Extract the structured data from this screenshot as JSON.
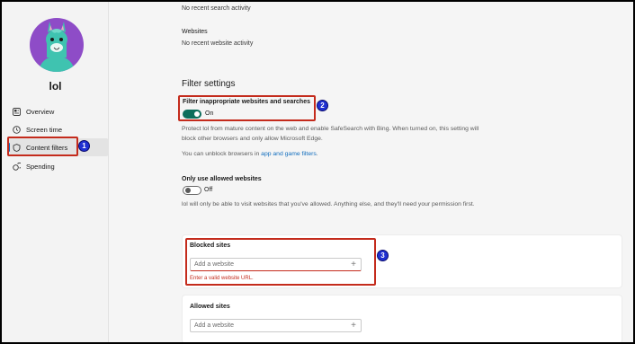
{
  "profile": {
    "name": "lol"
  },
  "sidebar": {
    "items": [
      {
        "label": "Overview",
        "icon": "overview-icon"
      },
      {
        "label": "Screen time",
        "icon": "clock-icon"
      },
      {
        "label": "Content filters",
        "icon": "shield-icon"
      },
      {
        "label": "Spending",
        "icon": "coins-icon"
      }
    ],
    "active_index": 2
  },
  "activity": {
    "search_empty": "No recent search activity",
    "websites_heading": "Websites",
    "websites_empty": "No recent website activity"
  },
  "filters": {
    "section_title": "Filter settings",
    "filter_toggle_label": "Filter inappropriate websites and searches",
    "filter_toggle_state": "On",
    "filter_desc": "Protect lol from mature content on the web and enable SafeSearch with Bing. When turned on, this setting will block other browsers and only allow Microsoft Edge.",
    "unblock_prefix": "You can unblock browsers in ",
    "unblock_link": "app and game filters",
    "unblock_suffix": ".",
    "allowed_only_label": "Only use allowed websites",
    "allowed_only_state": "Off",
    "allowed_only_desc": "lol will only be able to visit websites that you've allowed. Anything else, and they'll need your permission first."
  },
  "blocked_sites": {
    "title": "Blocked sites",
    "placeholder": "Add a website",
    "error": "Enter a valid website URL."
  },
  "allowed_sites": {
    "title": "Allowed sites",
    "placeholder": "Add a website"
  },
  "annotations": {
    "b1": "1",
    "b2": "2",
    "b3": "3"
  },
  "colors": {
    "accent": "#0f6cbd",
    "toggle_on": "#0d6e5c",
    "highlight": "#c42b1c",
    "badge": "#1f2fd1",
    "avatar_bg": "#8e4cc7",
    "llama": "#3fc3b0"
  }
}
